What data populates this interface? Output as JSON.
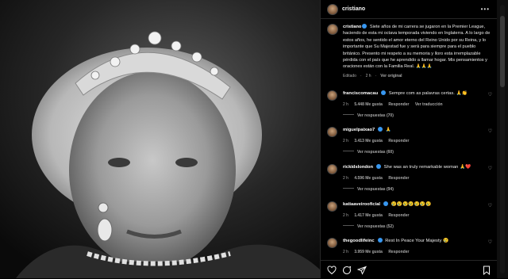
{
  "post": {
    "username": "cristiano",
    "more_icon": "ellipsis-icon"
  },
  "caption": {
    "username": "cristiano",
    "text": "Siete años de mi carrera se jugaron en la Premier League, haciendo de esta mi octava temporada viviendo en Inglaterra. A lo largo de estos años, he sentido el amor eterno del Reino Unido por su Reina, y lo importante que Su Majestad fue y será para siempre para el pueblo británico. Presento mi respeto a su memoria y lloro esta irremplazable pérdida con el país que he aprendido a llamar hogar. Mis pensamientos y oraciones están con la Familia Real. 🙏🙏🙏",
    "edited": "Editado",
    "age": "2 h",
    "see_original": "Ver original"
  },
  "comments": [
    {
      "user": "franciscomacau",
      "verified": true,
      "text": "Sempre com as palavras certas. 🙏👏",
      "age": "2 h",
      "likes": "5.448 Me gusta",
      "reply": "Responder",
      "translate": "Ver traducción",
      "replies": "Ver respuestas (70)"
    },
    {
      "user": "miguelpaixao7",
      "verified": true,
      "text": "🙏",
      "age": "2 h",
      "likes": "3.413 Me gusta",
      "reply": "Responder",
      "translate": "",
      "replies": "Ver respuestas (60)"
    },
    {
      "user": "rickidslondon",
      "verified": true,
      "text": "She was an truly remarkable woman 🙏❤️",
      "age": "2 h",
      "likes": "4.596 Me gusta",
      "reply": "Responder",
      "translate": "",
      "replies": "Ver respuestas (94)"
    },
    {
      "user": "katiaaveirooficial",
      "verified": true,
      "text": "😢😢😢😢😢😢😢",
      "age": "2 h",
      "likes": "1.417 Me gusta",
      "reply": "Responder",
      "translate": "",
      "replies": "Ver respuestas (52)"
    },
    {
      "user": "thegoodlifeinc",
      "verified": true,
      "text": "Rest In Peace Your Majesty 😢",
      "age": "2 h",
      "likes": "3.959 Me gusta",
      "reply": "Responder",
      "translate": "",
      "replies": ""
    }
  ],
  "actions": {
    "like_icon": "heart-icon",
    "comment_icon": "comment-icon",
    "share_icon": "share-icon",
    "save_icon": "bookmark-icon"
  },
  "colors": {
    "background": "#000000",
    "verified": "#3897f0",
    "muted_text": "#a8a8a8"
  }
}
